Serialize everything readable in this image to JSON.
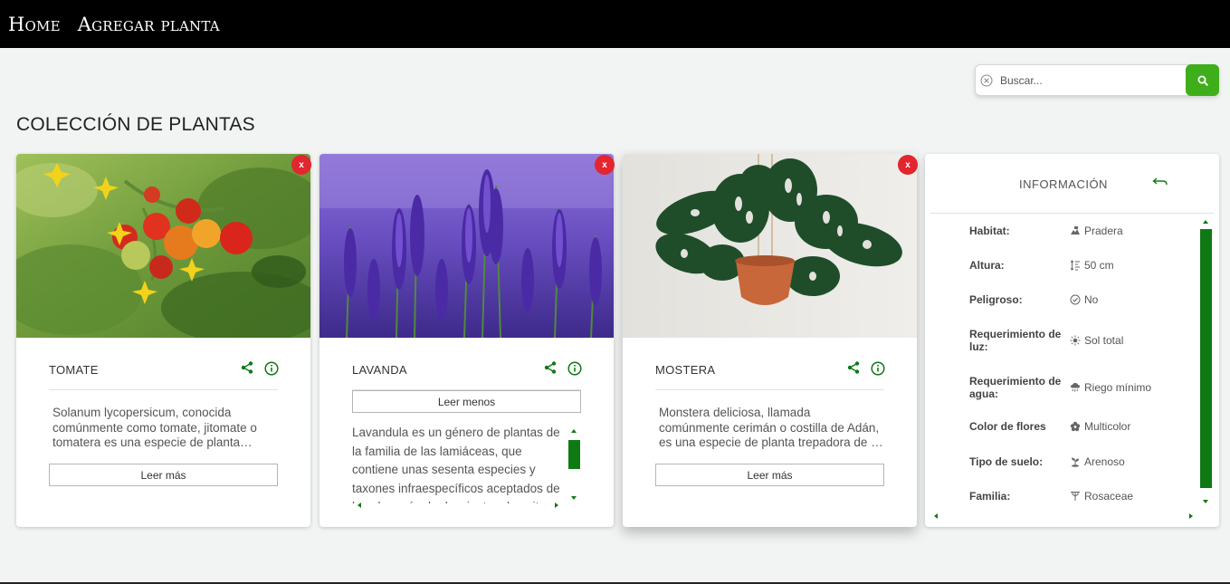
{
  "nav": {
    "home": "Home",
    "add_plant": "Agregar planta"
  },
  "search": {
    "placeholder": "Buscar..."
  },
  "page_title": "COLECCIÓN DE PLANTAS",
  "cards": [
    {
      "close": "x",
      "name": "TOMATE",
      "description": "Solanum lycopersicum, conocida comúnmente como tomate, jitomate o tomatera es una especie de planta herbácea del género Solanum",
      "button": "Leer más"
    },
    {
      "close": "x",
      "name": "LAVANDA",
      "button": "Leer menos",
      "description": "Lavandula es un género de plantas de la familia de las lamiáceas, que contiene unas sesenta especies y taxones infraespecíficos aceptados de los algo más de doscientos descritos."
    },
    {
      "close": "x",
      "name": "MOSTERA",
      "description": "Monstera deliciosa, llamada comúnmente cerimán o costilla de Adán, es una especie de planta trepadora de la familia de las aráceas",
      "button": "Leer más"
    }
  ],
  "info": {
    "title": "INFORMACIÓN",
    "rows": [
      {
        "label": "Habitat:",
        "value": "Pradera",
        "icon": "landscape-icon"
      },
      {
        "label": "Altura:",
        "value": "50 cm",
        "icon": "height-icon"
      },
      {
        "label": "Peligroso:",
        "value": "No",
        "icon": "check-circle-icon"
      },
      {
        "label": "Requerimiento de luz:",
        "value": "Sol total",
        "icon": "sun-icon"
      },
      {
        "label": "Requerimiento de agua:",
        "value": "Riego mínimo",
        "icon": "rain-icon"
      },
      {
        "label": "Color de flores",
        "value": "Multicolor",
        "icon": "flower-icon"
      },
      {
        "label": "Tipo de suelo:",
        "value": "Arenoso",
        "icon": "sprout-icon"
      },
      {
        "label": "Familia:",
        "value": "Rosaceae",
        "icon": "family-tree-icon"
      }
    ]
  },
  "colors": {
    "accent_green": "#3fae1b",
    "icon_green": "#0f7a14",
    "close_red": "#e2252f",
    "nav_bg": "#000000"
  }
}
